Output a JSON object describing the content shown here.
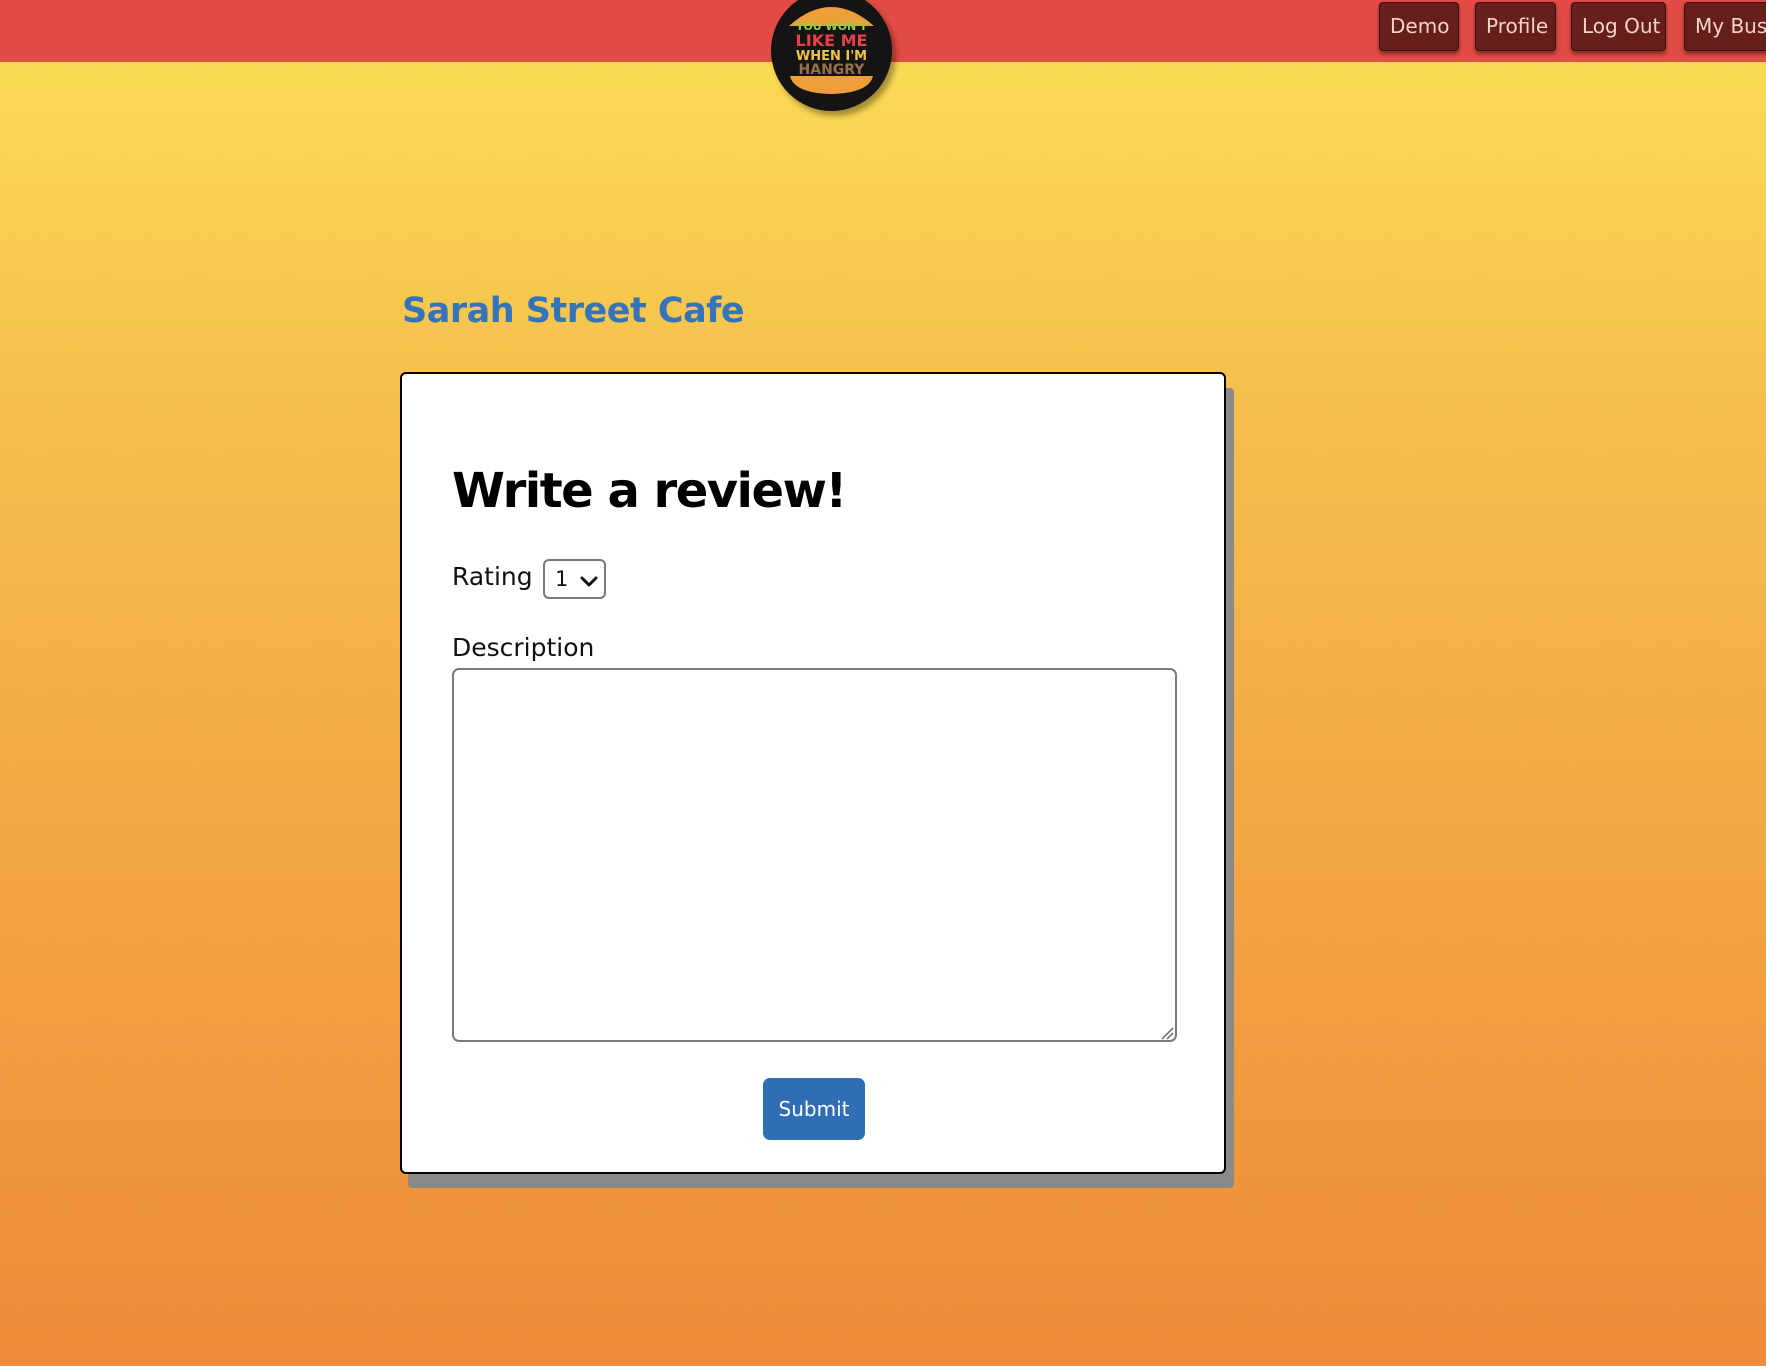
{
  "nav": {
    "buttons": [
      "Demo",
      "Profile",
      "Log Out",
      "My Business"
    ]
  },
  "logo": {
    "lines": [
      "YOU WON'T",
      "LIKE ME",
      "WHEN I'M",
      "HANGRY"
    ],
    "line_colors": [
      "#8fd04f",
      "#e8414a",
      "#f0c542",
      "#9a7048"
    ]
  },
  "business": {
    "name": "Sarah Street Cafe"
  },
  "review_form": {
    "title": "Write a review!",
    "rating_label": "Rating",
    "rating_value": "1",
    "description_label": "Description",
    "description_value": "",
    "submit_label": "Submit"
  },
  "colors": {
    "topbar": "#e24c45",
    "nav_button": "#671f1b",
    "business_name": "#3474bb",
    "submit": "#2f6db4"
  }
}
